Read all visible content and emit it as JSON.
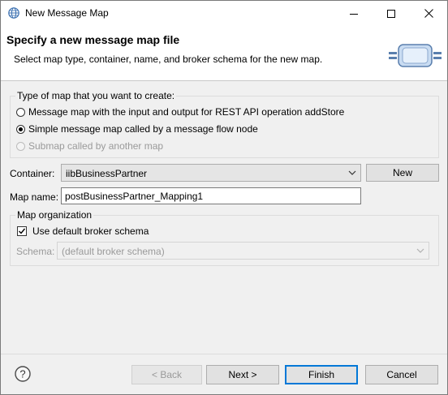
{
  "window": {
    "title": "New Message Map",
    "icon": "globe-icon"
  },
  "header": {
    "title": "Specify a new message map file",
    "description": "Select map type, container, name, and broker schema for the new map.",
    "banner_icon": "message-map-banner-icon"
  },
  "map_type": {
    "legend": "Type of map that you want to create:",
    "options": [
      {
        "label": "Message map with the input and output for REST API operation addStore",
        "checked": false,
        "enabled": true
      },
      {
        "label": "Simple message map called by a message flow node",
        "checked": true,
        "enabled": true
      },
      {
        "label": "Submap called by another map",
        "checked": false,
        "enabled": false
      }
    ]
  },
  "container": {
    "label": "Container:",
    "value": "iibBusinessPartner",
    "new_button": "New"
  },
  "map_name": {
    "label": "Map name:",
    "value": "postBusinessPartner_Mapping1"
  },
  "map_organization": {
    "legend": "Map organization",
    "use_default_label": "Use default broker schema",
    "use_default_checked": true,
    "schema_label": "Schema:",
    "schema_value": "(default broker schema)"
  },
  "footer": {
    "back": "< Back",
    "next": "Next >",
    "finish": "Finish",
    "cancel": "Cancel"
  },
  "colors": {
    "accent": "#0078d7",
    "dialog_bg": "#f0f0f0"
  }
}
